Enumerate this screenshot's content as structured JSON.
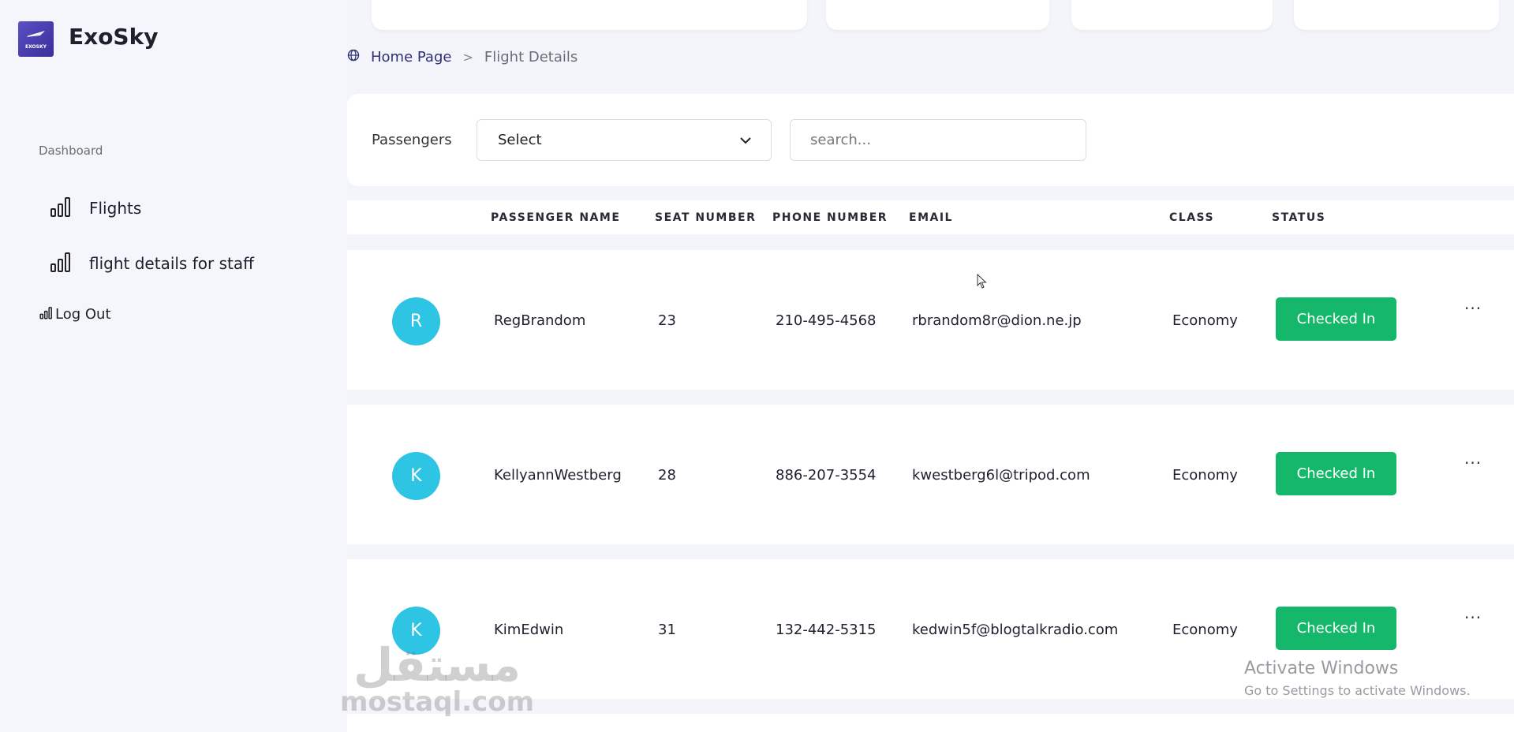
{
  "app": {
    "brand": "ExoSky",
    "logo_text": "EXOSKY"
  },
  "sidebar": {
    "section_label": "Dashboard",
    "items": [
      {
        "label": "Flights",
        "icon": "bar-chart-icon"
      },
      {
        "label": "flight details for staff",
        "icon": "bar-chart-icon"
      },
      {
        "label": "Log Out",
        "icon": "bar-chart-icon"
      }
    ]
  },
  "breadcrumb": {
    "icon": "globe-icon",
    "home": "Home Page",
    "separator": ">",
    "current": "Flight Details"
  },
  "filter": {
    "label": "Passengers",
    "select_value": "Select",
    "search_placeholder": "search..."
  },
  "table": {
    "columns": [
      "PASSENGER NAME",
      "SEAT NUMBER",
      "PHONE NUMBER",
      "EMAIL",
      "CLASS",
      "STATUS"
    ],
    "rows": [
      {
        "initial": "R",
        "name": "RegBrandom",
        "seat": "23",
        "phone": "210-495-4568",
        "email": "rbrandom8r@dion.ne.jp",
        "class": "Economy",
        "status": "Checked In",
        "more": "···"
      },
      {
        "initial": "K",
        "name": "KellyannWestberg",
        "seat": "28",
        "phone": "886-207-3554",
        "email": "kwestberg6l@tripod.com",
        "class": "Economy",
        "status": "Checked In",
        "more": "···"
      },
      {
        "initial": "K",
        "name": "KimEdwin",
        "seat": "31",
        "phone": "132-442-5315",
        "email": "kedwin5f@blogtalkradio.com",
        "class": "Economy",
        "status": "Checked In",
        "more": "···"
      }
    ]
  },
  "watermark": {
    "arabic": "مستقل",
    "latin": "mostaql.com"
  },
  "os_notice": {
    "title": "Activate Windows",
    "subtitle": "Go to Settings to activate Windows."
  },
  "colors": {
    "accent": "#15b86a",
    "avatar": "#2ec4e3",
    "brand_dark": "#2b2f74",
    "background": "#f4f5fb"
  }
}
